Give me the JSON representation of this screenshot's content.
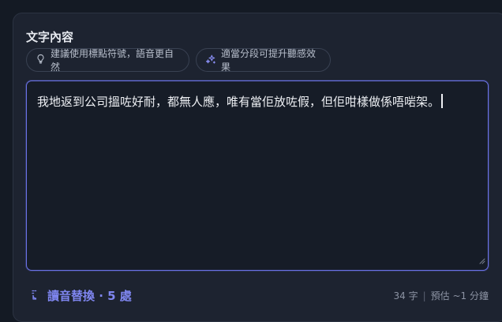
{
  "section": {
    "title": "文字內容"
  },
  "chips": [
    {
      "icon": "lightbulb-icon",
      "label": "建議使用標點符號，語音更自然"
    },
    {
      "icon": "sparkles-icon",
      "label": "適當分段可提升聽感效果"
    }
  ],
  "editor": {
    "text": "我地返到公司搵咗好耐，都無人應，唯有當佢放咗假，但佢咁樣做係唔啱架。"
  },
  "footer": {
    "replace_label": "讀音替換 · 5 處",
    "char_count": "34 字",
    "estimate": "預估 ~1 分鐘"
  },
  "colors": {
    "accent": "#7f86f0",
    "focus_border": "#6b72e6",
    "panel_bg": "#1d2330"
  }
}
